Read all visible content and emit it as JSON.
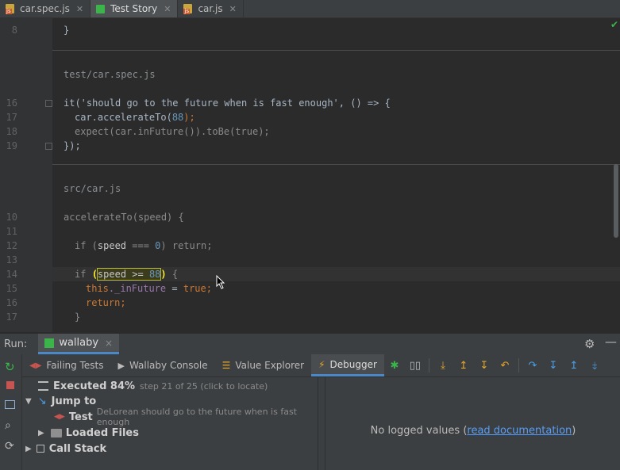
{
  "tabs": [
    {
      "label": "car.spec.js",
      "icon": "js-file-icon",
      "active": false
    },
    {
      "label": "Test Story",
      "icon": "story-icon",
      "active": true
    },
    {
      "label": "car.js",
      "icon": "js-file-icon",
      "active": false
    }
  ],
  "editor": {
    "line_numbers": [
      "8",
      "16",
      "17",
      "18",
      "19",
      "10",
      "11",
      "12",
      "13",
      "14",
      "15",
      "16",
      "17"
    ],
    "sections": [
      "test/car.spec.js",
      "src/car.js"
    ],
    "code": {
      "l8": "}",
      "l16a": "it('should go to the future when is fast enough', () => {",
      "l17a_pre": "car.accelerateTo(",
      "l17a_num": "88",
      "l17a_post": ");",
      "l18a": "expect(car.inFuture()).toBe(true);",
      "l19a": "});",
      "l10": "accelerateTo(speed) {",
      "l12_pre": "if (",
      "l12_var": "speed",
      "l12_mid": " === ",
      "l12_num": "0",
      "l12_post": ") return;",
      "l14_pre": "if ",
      "l14_paren_open": "(",
      "l14_var": "speed",
      "l14_mid": " >= ",
      "l14_num": "88",
      "l14_paren_close": ")",
      "l14_post": " {",
      "l15_this": "this",
      "l15_prop": "._inFuture",
      "l15_post": " = ",
      "l15_val": "true",
      "l15_end": ";",
      "l16b": "return;",
      "l17b": "}"
    },
    "status_check": "✔"
  },
  "run": {
    "label": "Run:",
    "config_name": "wallaby",
    "close": "×"
  },
  "toolbar_tabs": [
    {
      "label": "Failing Tests",
      "icon": "failing-tests-icon"
    },
    {
      "label": "Wallaby Console",
      "icon": "console-icon"
    },
    {
      "label": "Value Explorer",
      "icon": "value-explorer-icon"
    },
    {
      "label": "Debugger",
      "icon": "lightning-icon"
    }
  ],
  "debugger": {
    "executed_label": "Executed 84%",
    "step_info": "step 21 of 25 (click to locate)",
    "progress_percent": 84,
    "jump_to": "Jump to",
    "test_label": "Test",
    "test_name": "DeLorean should go to the future when is fast enough",
    "loaded_files": "Loaded Files",
    "call_stack": "Call Stack",
    "no_values_prefix": "No logged values (",
    "read_documentation": "read documentation",
    "no_values_suffix": ")"
  },
  "colors": {
    "accent": "#4a88c7",
    "success": "#3bb54a",
    "danger": "#c75450",
    "warning": "#e6a628"
  }
}
